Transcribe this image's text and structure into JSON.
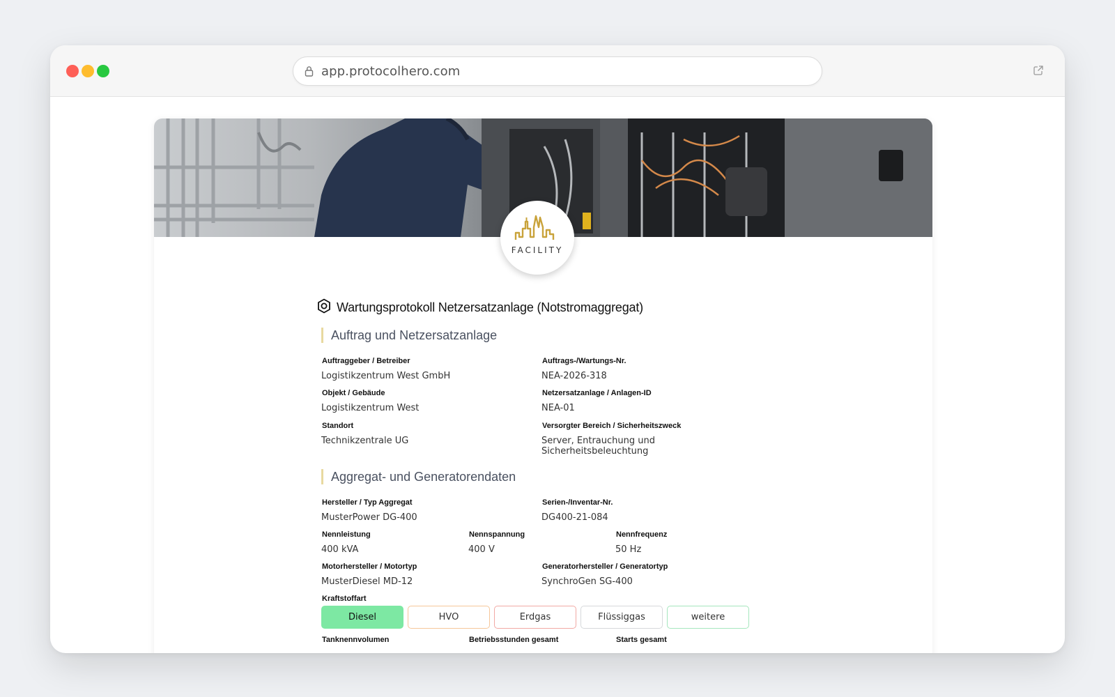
{
  "browser": {
    "url": "app.protocolhero.com"
  },
  "brand": {
    "logo_text": "FACILITY"
  },
  "form": {
    "title": "Wartungsprotokoll Netzersatzanlage (Notstromaggregat)"
  },
  "section1": {
    "heading": "Auftrag und Netzersatzanlage",
    "fields": [
      {
        "label": "Auftraggeber / Betreiber",
        "value": "Logistikzentrum West GmbH"
      },
      {
        "label": "Auftrags-/Wartungs-Nr.",
        "value": "NEA-2026-318"
      },
      {
        "label": "Objekt / Gebäude",
        "value": "Logistikzentrum West"
      },
      {
        "label": "Netzersatzanlage / Anlagen-ID",
        "value": "NEA-01"
      },
      {
        "label": "Standort",
        "value": "Technikzentrale UG"
      },
      {
        "label": "Versorgter Bereich / Sicherheitszweck",
        "value": "Server, Entrauchung und Sicherheitsbeleuchtung"
      }
    ]
  },
  "section2": {
    "heading": "Aggregat- und Generatorendaten",
    "fields": [
      {
        "label": "Hersteller / Typ Aggregat",
        "value": "MusterPower DG-400"
      },
      {
        "label": "Serien-/Inventar-Nr.",
        "value": "DG400-21-084"
      },
      {
        "label": "Nennleistung",
        "value": "400 kVA"
      },
      {
        "label": "Nennspannung",
        "value": "400 V"
      },
      {
        "label": "Nennfrequenz",
        "value": "50 Hz"
      },
      {
        "label": "Motorhersteller / Motortyp",
        "value": "MusterDiesel MD-12"
      },
      {
        "label": "Generatorhersteller / Generatortyp",
        "value": "SynchroGen SG-400"
      }
    ],
    "fuel": {
      "label": "Kraftstoffart",
      "selected": "Diesel",
      "options": [
        {
          "label": "Diesel",
          "color": "#7de8a3"
        },
        {
          "label": "HVO",
          "color": "#f6c79a"
        },
        {
          "label": "Erdgas",
          "color": "#f2a9a4"
        },
        {
          "label": "Flüssiggas",
          "color": "#d6d8db"
        },
        {
          "label": "weitere",
          "color": "#a5e6bd"
        }
      ]
    },
    "more_labels": [
      "Tanknennvolumen",
      "Betriebsstunden gesamt",
      "Starts gesamt"
    ]
  },
  "colors": {
    "section_accent": "#e8d9a0",
    "logo_gold": "#c9a33b",
    "selected_option": "#7de8a3"
  }
}
